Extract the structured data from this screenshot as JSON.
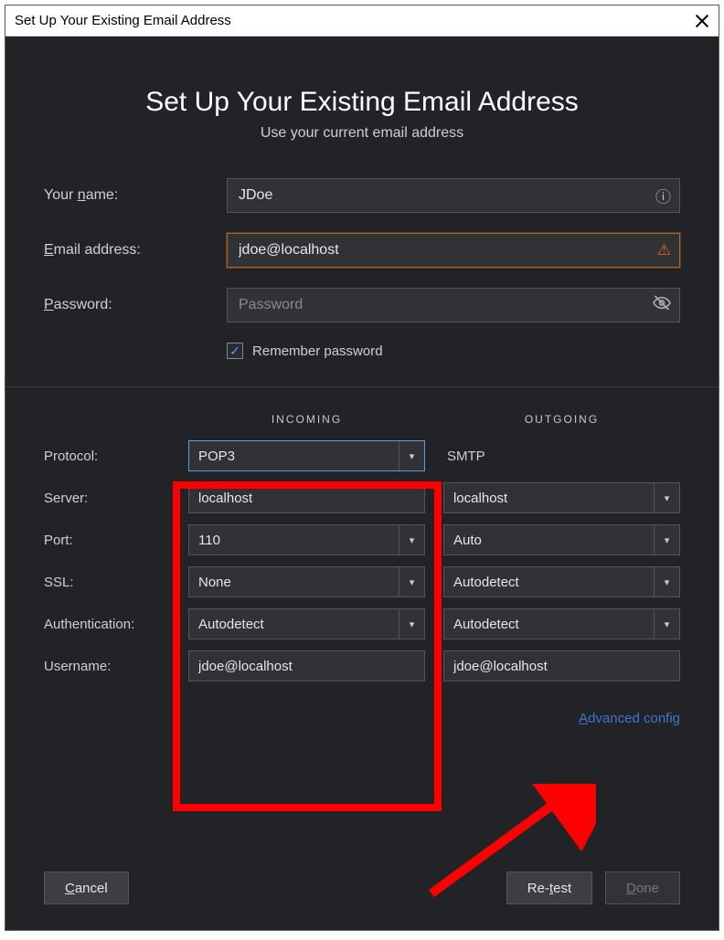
{
  "titlebar": {
    "title": "Set Up Your Existing Email Address"
  },
  "header": {
    "title": "Set Up Your Existing Email Address",
    "subtitle": "Use your current email address"
  },
  "form": {
    "name_label": "Your name:",
    "name_value": "JDoe",
    "email_label": "Email address:",
    "email_value": "jdoe@localhost",
    "password_label": "Password:",
    "password_placeholder": "Password",
    "password_value": "",
    "remember_label": "Remember password",
    "remember_checked": true
  },
  "config": {
    "incoming_label": "INCOMING",
    "outgoing_label": "OUTGOING",
    "rows": {
      "protocol_label": "Protocol:",
      "protocol_in": "POP3",
      "protocol_out": "SMTP",
      "server_label": "Server:",
      "server_in": "localhost",
      "server_out": "localhost",
      "port_label": "Port:",
      "port_in": "110",
      "port_out": "Auto",
      "ssl_label": "SSL:",
      "ssl_in": "None",
      "ssl_out": "Autodetect",
      "auth_label": "Authentication:",
      "auth_in": "Autodetect",
      "auth_out": "Autodetect",
      "user_label": "Username:",
      "user_in": "jdoe@localhost",
      "user_out": "jdoe@localhost"
    },
    "advanced_link": "Advanced config"
  },
  "buttons": {
    "cancel": "Cancel",
    "retest": "Re-test",
    "done": "Done"
  }
}
